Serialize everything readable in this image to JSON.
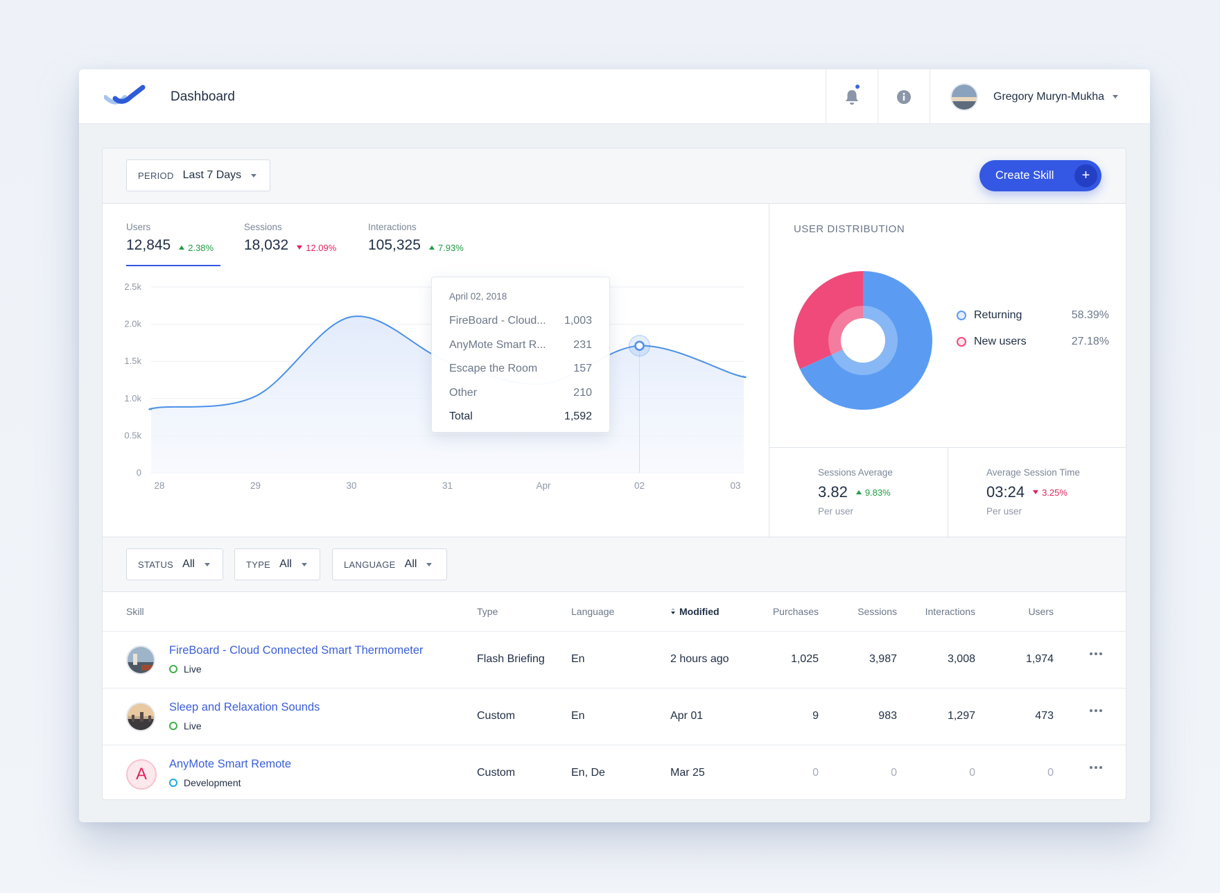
{
  "header": {
    "title": "Dashboard",
    "user_name": "Gregory Muryn-Mukha"
  },
  "toolbar": {
    "period_label": "PERIOD",
    "period_value": "Last 7 Days",
    "create_label": "Create Skill"
  },
  "stats": [
    {
      "label": "Users",
      "value": "12,845",
      "delta": "2.38%",
      "direction": "up"
    },
    {
      "label": "Sessions",
      "value": "18,032",
      "delta": "12.09%",
      "direction": "down"
    },
    {
      "label": "Interactions",
      "value": "105,325",
      "delta": "7.93%",
      "direction": "up"
    }
  ],
  "chart_data": {
    "type": "area",
    "x": [
      "28",
      "29",
      "30",
      "31",
      "Apr",
      "02",
      "03"
    ],
    "yticks": [
      "0",
      "0.5k",
      "1.0k",
      "1.5k",
      "2.0k",
      "2.5k"
    ],
    "ylim": [
      0,
      2500
    ],
    "series": [
      {
        "values": [
          880,
          1030,
          2100,
          1500,
          1200,
          1710,
          1320
        ]
      }
    ],
    "highlight_index": 5,
    "color": "#4a90e8"
  },
  "tooltip": {
    "date": "April 02, 2018",
    "rows": [
      {
        "name": "FireBoard - Cloud...",
        "value": "1,003"
      },
      {
        "name": "AnyMote Smart R...",
        "value": "231"
      },
      {
        "name": "Escape the Room",
        "value": "157"
      },
      {
        "name": "Other",
        "value": "210"
      }
    ],
    "total_label": "Total",
    "total_value": "1,592"
  },
  "distribution": {
    "title": "USER DISTRIBUTION",
    "segments": [
      {
        "name": "Returning",
        "pct": "58.39%",
        "value": 58.39,
        "color": "#5b9cf2"
      },
      {
        "name": "New users",
        "pct": "27.18%",
        "value": 27.18,
        "color": "#ef4a7a"
      }
    ]
  },
  "metrics": [
    {
      "label": "Sessions Average",
      "value": "3.82",
      "delta": "9.83%",
      "direction": "up",
      "sub": "Per user"
    },
    {
      "label": "Average Session Time",
      "value": "03:24",
      "delta": "3.25%",
      "direction": "down",
      "sub": "Per user"
    }
  ],
  "filters": [
    {
      "label": "STATUS",
      "value": "All"
    },
    {
      "label": "TYPE",
      "value": "All"
    },
    {
      "label": "LANGUAGE",
      "value": "All"
    }
  ],
  "table": {
    "headers": [
      "Skill",
      "Type",
      "Language",
      "Modified",
      "Purchases",
      "Sessions",
      "Interactions",
      "Users"
    ],
    "rows": [
      {
        "name": "FireBoard - Cloud Connected Smart Thermometer",
        "status": "Live",
        "status_color": "#3cb04a",
        "type": "Flash Briefing",
        "language": "En",
        "modified": "2 hours ago",
        "purchases": "1,025",
        "sessions": "3,987",
        "interactions": "3,008",
        "users": "1,974"
      },
      {
        "name": "Sleep and Relaxation Sounds",
        "status": "Live",
        "status_color": "#3cb04a",
        "type": "Custom",
        "language": "En",
        "modified": "Apr 01",
        "purchases": "9",
        "sessions": "983",
        "interactions": "1,297",
        "users": "473"
      },
      {
        "name": "AnyMote Smart Remote",
        "status": "Development",
        "status_color": "#22a8e0",
        "letter": "A",
        "type": "Custom",
        "language": "En, De",
        "modified": "Mar 25",
        "purchases": "0",
        "sessions": "0",
        "interactions": "0",
        "users": "0"
      }
    ]
  }
}
